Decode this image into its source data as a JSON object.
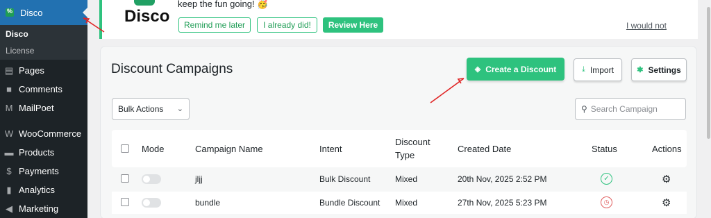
{
  "sidebar": {
    "active": {
      "label": "Disco",
      "icon": "disco-percent-icon"
    },
    "submenu": [
      "Disco",
      "License"
    ],
    "items": [
      {
        "label": "Pages",
        "icon": "pages-icon",
        "glyph": "▤"
      },
      {
        "label": "Comments",
        "icon": "comment-icon",
        "glyph": "■"
      },
      {
        "label": "MailPoet",
        "icon": "mailpoet-icon",
        "glyph": "M"
      },
      {
        "label": "WooCommerce",
        "icon": "woocommerce-icon",
        "glyph": "W"
      },
      {
        "label": "Products",
        "icon": "products-icon",
        "glyph": "▬"
      },
      {
        "label": "Payments",
        "icon": "payments-icon",
        "glyph": "$"
      },
      {
        "label": "Analytics",
        "icon": "analytics-icon",
        "glyph": "▮"
      },
      {
        "label": "Marketing",
        "icon": "marketing-icon",
        "glyph": "◀"
      }
    ]
  },
  "notice": {
    "logo_text": "Disco",
    "badge": "%",
    "message": "keep the fun going! 🥳",
    "buttons": [
      "Remind me later",
      "I already did!",
      "Review Here"
    ],
    "dismiss": "I would not"
  },
  "main": {
    "title": "Discount Campaigns",
    "create_label": "Create a Discount",
    "import_label": "Import",
    "settings_label": "Settings",
    "bulk_label": "Bulk Actions",
    "search_placeholder": "Search Campaign"
  },
  "table": {
    "headers": {
      "mode": "Mode",
      "name": "Campaign Name",
      "intent": "Intent",
      "type_line1": "Discount",
      "type_line2": "Type",
      "created": "Created Date",
      "status": "Status",
      "actions": "Actions"
    },
    "rows": [
      {
        "name": "jljj",
        "intent": "Bulk Discount",
        "type": "Mixed",
        "created": "20th Nov, 2025 2:52 PM",
        "status": "active"
      },
      {
        "name": "bundle",
        "intent": "Bundle Discount",
        "type": "Mixed",
        "created": "27th Nov, 2025 5:23 PM",
        "status": "scheduled"
      }
    ]
  },
  "colors": {
    "brand": "#2ec27e",
    "wp_blue": "#2271b1",
    "sidebar": "#1d2327",
    "annotation": "#e02424"
  }
}
